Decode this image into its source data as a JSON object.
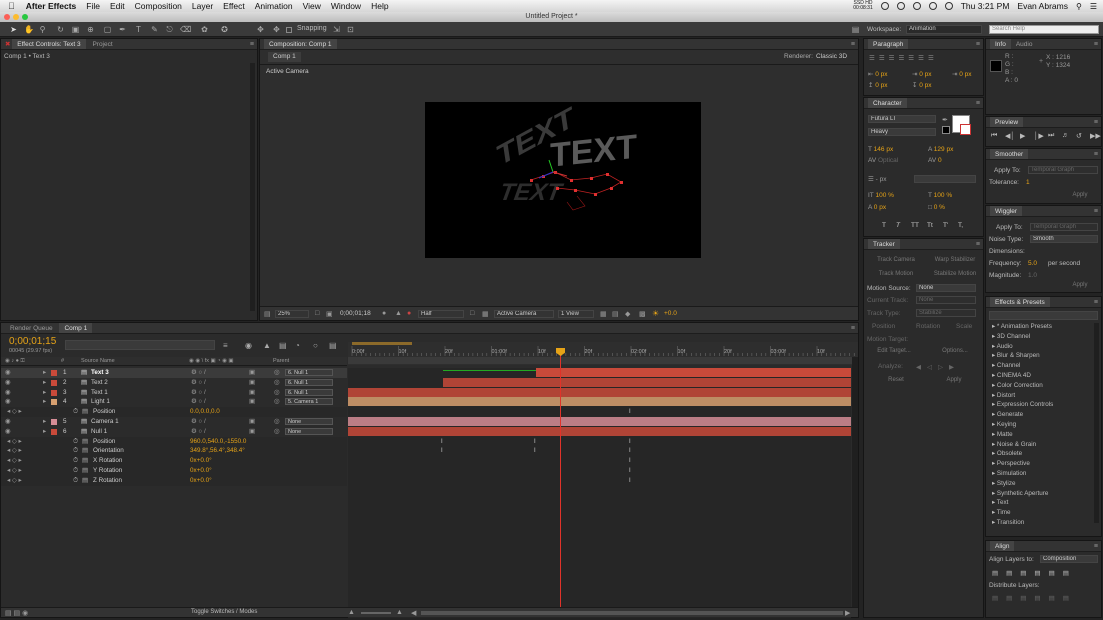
{
  "menubar": {
    "app": "After Effects",
    "items": [
      "File",
      "Edit",
      "Composition",
      "Layer",
      "Effect",
      "Animation",
      "View",
      "Window",
      "Help"
    ],
    "clock": "Thu 3:21 PM",
    "user": "Evan Abrams",
    "ssd_top": "SSD HD",
    "ssd_bottom": "00:08:31"
  },
  "window_title": "Untitled Project *",
  "toolbar": {
    "snapping": "Snapping",
    "workspace_label": "Workspace:",
    "workspace_value": "Animation",
    "search_placeholder": "Search Help"
  },
  "effect_controls": {
    "tab": "Effect Controls: Text 3",
    "tab2": "Project",
    "breadcrumb": "Comp 1 • Text 3"
  },
  "composition": {
    "tab": "Composition: Comp 1",
    "subtab": "Comp 1",
    "renderer_label": "Renderer:",
    "renderer": "Classic 3D",
    "camera_label": "Active Camera",
    "scene_text_1": "TEXT",
    "scene_text_2": "TEXT",
    "scene_text_3": "TEXT",
    "footer": {
      "zoom": "25%",
      "time": "0;00;01;18",
      "resolution": "Half",
      "camera": "Active Camera",
      "views": "1 View",
      "exposure": "+0.0"
    }
  },
  "paragraph": {
    "title": "Paragraph",
    "f1": "0 px",
    "f2": "0 px",
    "f3": "0 px",
    "f4": "0 px",
    "f5": "0 px"
  },
  "info": {
    "tab1": "Info",
    "tab2": "Audio",
    "r": "R :",
    "g": "G :",
    "b": "B :",
    "a": "A : 0",
    "x": "X : 1216",
    "y": "Y : 1324"
  },
  "preview": {
    "title": "Preview"
  },
  "smoother": {
    "title": "Smoother",
    "apply_to_label": "Apply To:",
    "apply_to": "Temporal Graph",
    "tolerance_label": "Tolerance:",
    "tolerance": "1",
    "apply": "Apply"
  },
  "character": {
    "title": "Character",
    "font": "Futura LT",
    "style": "Heavy",
    "size": "146 px",
    "leading": "129 px",
    "kerning": "Optical",
    "tracking": "0",
    "stroke": "- px",
    "vscale": "100 %",
    "hscale": "100 %",
    "baseline": "0 px",
    "tsume": "0 %",
    "styles": [
      "T",
      "T",
      "TT",
      "Tt",
      "T'",
      "T,"
    ]
  },
  "wiggler": {
    "title": "Wiggler",
    "apply_to_label": "Apply To:",
    "apply_to": "Temporal Graph",
    "noise_label": "Noise Type:",
    "noise": "Smooth",
    "dimensions_label": "Dimensions:",
    "frequency_label": "Frequency:",
    "frequency": "5.0",
    "frequency_unit": "per second",
    "magnitude_label": "Magnitude:",
    "magnitude": "1.0",
    "apply": "Apply"
  },
  "tracker": {
    "title": "Tracker",
    "track_camera": "Track Camera",
    "warp_stabilizer": "Warp Stabilizer",
    "track_motion": "Track Motion",
    "stabilize_motion": "Stabilize Motion",
    "motion_source_label": "Motion Source:",
    "motion_source": "None",
    "current_track_label": "Current Track:",
    "current_track": "None",
    "track_type_label": "Track Type:",
    "track_type": "Stabilize",
    "position": "Position",
    "rotation": "Rotation",
    "scale": "Scale",
    "motion_target_label": "Motion Target:",
    "edit_target": "Edit Target...",
    "options": "Options...",
    "analyze_label": "Analyze:",
    "reset": "Reset",
    "apply": "Apply"
  },
  "effects_presets": {
    "title": "Effects & Presets",
    "items": [
      "* Animation Presets",
      "3D Channel",
      "Audio",
      "Blur & Sharpen",
      "Channel",
      "CINEMA 4D",
      "Color Correction",
      "Distort",
      "Expression Controls",
      "Generate",
      "Keying",
      "Matte",
      "Noise & Grain",
      "Obsolete",
      "Perspective",
      "Simulation",
      "Stylize",
      "Synthetic Aperture",
      "Text",
      "Time",
      "Transition"
    ]
  },
  "align": {
    "title": "Align",
    "align_to_label": "Align Layers to:",
    "align_to": "Composition",
    "distribute": "Distribute Layers:"
  },
  "timeline": {
    "tab1": "Render Queue",
    "tab2": "Comp 1",
    "timecode": "0;00;01;15",
    "fps": "00045 (29.97 fps)",
    "col_source": "Source Name",
    "col_parent": "Parent",
    "col_num": "#",
    "toggle": "Toggle Switches / Modes",
    "ruler": [
      "0:00f",
      "10f",
      "20f",
      "01:00f",
      "10f",
      "20f",
      "02:00f",
      "10f",
      "20f",
      "03:00f",
      "10f"
    ],
    "layers": [
      {
        "num": "1",
        "name": "Text 3",
        "parent": "6. Null 1",
        "color": "#c94a3a"
      },
      {
        "num": "2",
        "name": "Text 2",
        "parent": "6. Null 1",
        "color": "#c94a3a"
      },
      {
        "num": "3",
        "name": "Text 1",
        "parent": "6. Null 1",
        "color": "#c94a3a"
      },
      {
        "num": "4",
        "name": "Light 1",
        "parent": "5. Camera 1",
        "color": "#d8a070"
      },
      {
        "num": "",
        "name": "Position",
        "value": "0.0,0.0,0.0",
        "parent": "",
        "color": ""
      },
      {
        "num": "5",
        "name": "Camera 1",
        "parent": "None",
        "color": "#d68d96"
      },
      {
        "num": "6",
        "name": "Null 1",
        "parent": "None",
        "color": "#c94a3a"
      },
      {
        "num": "",
        "name": "Position",
        "value": "960.0,540.0,-1550.0",
        "parent": "",
        "color": ""
      },
      {
        "num": "",
        "name": "Orientation",
        "value": "349.8°,56.4°,348.4°",
        "parent": "",
        "color": ""
      },
      {
        "num": "",
        "name": "X Rotation",
        "value": "0x+0.0°",
        "parent": "",
        "color": ""
      },
      {
        "num": "",
        "name": "Y Rotation",
        "value": "0x+0.0°",
        "parent": "",
        "color": ""
      },
      {
        "num": "",
        "name": "Z Rotation",
        "value": "0x+0.0°",
        "parent": "",
        "color": ""
      }
    ]
  }
}
